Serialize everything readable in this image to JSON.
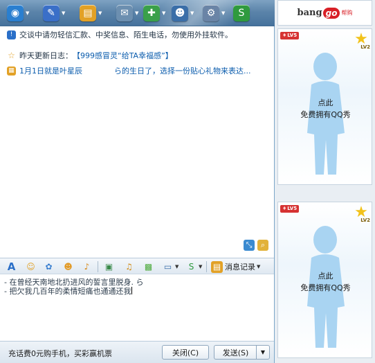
{
  "toolbar": {
    "buttons": [
      {
        "icon": "video-call-icon",
        "glyph": "◉",
        "color": "#2a7fd0"
      },
      {
        "icon": "microphone-icon",
        "glyph": "✎",
        "color": "#3a6fc8"
      },
      {
        "icon": "send-file-icon",
        "glyph": "▤",
        "color": "#e2a126"
      },
      {
        "icon": "sms-envelope-icon",
        "glyph": "✉",
        "color": "#6c8fb0"
      },
      {
        "icon": "add-app-icon",
        "glyph": "✚",
        "color": "#3aa04a"
      },
      {
        "icon": "user-settings-icon",
        "glyph": "☻",
        "color": "#3a6ea8"
      },
      {
        "icon": "options-gear-icon",
        "glyph": "⚙",
        "color": "#6a84a6"
      },
      {
        "icon": "soso-search-icon",
        "glyph": "S",
        "color": "#2f9a3e"
      }
    ]
  },
  "notices": {
    "warning_icon": "info-shield-icon",
    "warning": "交谈中请勿轻信汇款、中奖信息、陌生电话，勿使用外挂软件。",
    "update_icon": "star-icon",
    "update_label": "昨天更新日志：",
    "update_link": "【999感冒灵“给TA幸福感”】",
    "birthday_icon": "gift-icon",
    "birthday_prefix": "1月1日就是叶星辰",
    "birthday_suffix": "ら的生日了，选择一份贴心礼物来表达..."
  },
  "corner_icons": [
    "resize-icon",
    "zoom-icon"
  ],
  "format_bar": {
    "items": [
      {
        "name": "font-icon",
        "glyph": "A",
        "color": "#2a6fc8"
      },
      {
        "name": "emoticon-icon",
        "glyph": "☺",
        "color": "#e2a126"
      },
      {
        "name": "magic-emoticon-icon",
        "glyph": "✿",
        "color": "#3a7fd0"
      },
      {
        "name": "shake-window-icon",
        "glyph": "☻",
        "color": "#e29a26"
      },
      {
        "name": "voice-message-icon",
        "glyph": "♪",
        "color": "#d98a1a"
      },
      {
        "name": "send-image-icon",
        "glyph": "▣",
        "color": "#3a8a4a"
      },
      {
        "name": "music-icon",
        "glyph": "♫",
        "color": "#d18a12"
      },
      {
        "name": "gift-icon",
        "glyph": "▩",
        "color": "#4caa3a"
      },
      {
        "name": "screen-capture-icon",
        "glyph": "▭",
        "color": "#3a6ea8"
      },
      {
        "name": "soso-search-icon",
        "glyph": "S",
        "color": "#2f9a3e"
      }
    ],
    "history_icon": "message-history-icon",
    "history_label": "消息记录"
  },
  "input": {
    "line1": "- 在曾经天南地北扔进风的誓言里脱身. ら",
    "line2": " -  把欠我几百年的柔情短痛也通通还我"
  },
  "bottom": {
    "promo": "充话费0元购手机，买彩赢机票",
    "close_label": "关闭(C)",
    "send_label": "发送(S)",
    "send_arrow": "▼"
  },
  "right_panel": {
    "ad": {
      "brand": "bang",
      "go": "go",
      "cn": "帮购"
    },
    "cards": [
      {
        "level": "LV5",
        "star_level": "LV2",
        "line1": "点此",
        "line2": "免费拥有QQ秀"
      },
      {
        "level": "LV5",
        "star_level": "LV2",
        "line1": "点此",
        "line2": "免费拥有QQ秀"
      }
    ]
  }
}
